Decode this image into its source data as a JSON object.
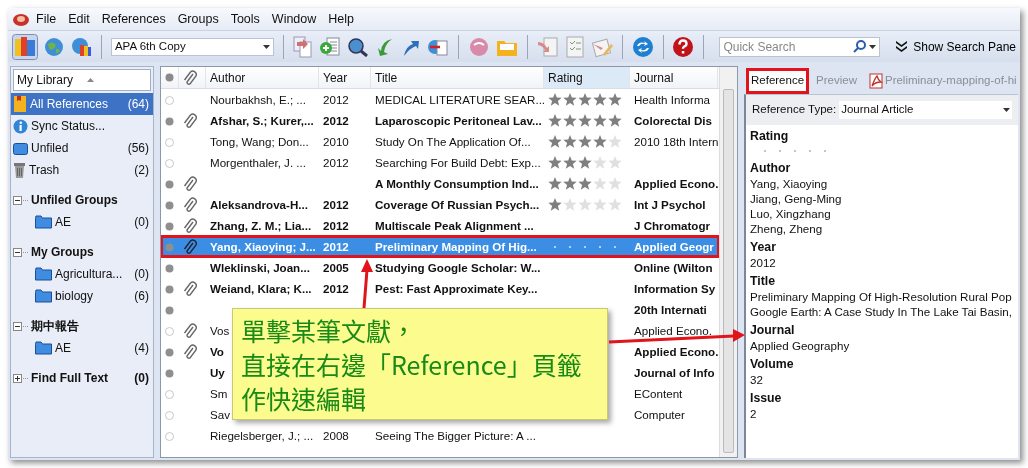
{
  "menu": [
    "File",
    "Edit",
    "References",
    "Groups",
    "Tools",
    "Window",
    "Help"
  ],
  "toolbar": {
    "style": "APA 6th Copy",
    "search_placeholder": "Quick Search",
    "search_panel_button": "Show Search Pane"
  },
  "sidebar": {
    "header": "My Library",
    "items": [
      {
        "label": "All References",
        "count": "(64)",
        "selected": true,
        "kind": "all"
      },
      {
        "label": "Sync Status...",
        "selected": false,
        "kind": "sync"
      },
      {
        "label": "Unfiled",
        "count": "(56)",
        "selected": false,
        "kind": "unfiled"
      },
      {
        "label": "Trash",
        "count": "(2)",
        "selected": false,
        "kind": "trash"
      }
    ],
    "groups": [
      {
        "label": "Unfiled Groups",
        "expanded": true,
        "children": [
          {
            "label": "AE",
            "count": "(0)"
          }
        ]
      },
      {
        "label": "My Groups",
        "expanded": true,
        "children": [
          {
            "label": "Agricultura...",
            "count": "(0)"
          },
          {
            "label": "biology",
            "count": "(6)"
          }
        ]
      },
      {
        "label": "期中報告",
        "expanded": true,
        "children": [
          {
            "label": "AE",
            "count": "(4)"
          }
        ]
      },
      {
        "label": "Find Full Text",
        "count": "(0)",
        "expanded": false
      }
    ]
  },
  "table": {
    "columns": [
      {
        "label": "Author",
        "sorted": false
      },
      {
        "label": "Year",
        "sorted": false
      },
      {
        "label": "Title",
        "sorted": false
      },
      {
        "label": "Rating",
        "sorted": true
      },
      {
        "label": "Journal",
        "sorted": false
      }
    ],
    "rows": [
      {
        "read": true,
        "attachment": false,
        "selected": false,
        "highlighted": false,
        "author": "Nourbakhsh, E.; ...",
        "year": "2012",
        "title": "MEDICAL LITERATURE SEAR...",
        "stars": 5,
        "journal": "Health Informa"
      },
      {
        "read": false,
        "attachment": true,
        "selected": false,
        "highlighted": false,
        "author": "Afshar, S.; Kurer,...",
        "year": "2012",
        "title": "Laparoscopic Peritoneal Lav...",
        "stars": 5,
        "journal": "Colorectal Dis"
      },
      {
        "read": true,
        "attachment": false,
        "selected": false,
        "highlighted": false,
        "author": "Tong, Wang; Don...",
        "year": "2010",
        "title": "Study On The Application Of...",
        "stars": 4,
        "journal": "2010 18th Intern"
      },
      {
        "read": true,
        "attachment": false,
        "selected": false,
        "highlighted": false,
        "author": "Morgenthaler, J. ...",
        "year": "2012",
        "title": "Searching For Build Debt: Exp...",
        "stars": 3
      },
      {
        "read": false,
        "attachment": true,
        "selected": false,
        "highlighted": false,
        "title": "A Monthly Consumption Ind...",
        "stars": 3,
        "journal": "Applied Econo."
      },
      {
        "read": false,
        "attachment": true,
        "selected": false,
        "highlighted": false,
        "author": "Aleksandrova-H...",
        "year": "2012",
        "title": "Coverage Of Russian Psych...",
        "stars": 1,
        "journal": "Int J Psychol"
      },
      {
        "read": false,
        "attachment": true,
        "selected": false,
        "highlighted": false,
        "author": "Zhang, Z. M.; Lia...",
        "year": "2012",
        "title": "Multiscale Peak Alignment ...",
        "journal": "J Chromatogr"
      },
      {
        "read": false,
        "attachment": true,
        "selected": true,
        "highlighted": true,
        "author": "Yang, Xiaoying; J...",
        "year": "2012",
        "title": "Preliminary Mapping Of Hig...",
        "journal": "Applied Geogr"
      },
      {
        "read": false,
        "attachment": false,
        "selected": false,
        "highlighted": false,
        "author": "Wleklinski, Joan...",
        "year": "2005",
        "title": "Studying Google Scholar: W...",
        "journal": "Online (Wilton"
      },
      {
        "read": false,
        "attachment": true,
        "selected": false,
        "highlighted": false,
        "author": "Weiand, Klara; K...",
        "year": "2012",
        "title": "Pest: Fast Approximate Key...",
        "journal": "Information Sy"
      },
      {
        "read": false,
        "attachment": false,
        "selected": false,
        "highlighted": false,
        "journal": "20th Internati"
      },
      {
        "read": true,
        "attachment": true,
        "selected": false,
        "highlighted": false,
        "author": "Vos",
        "journal": "Applied Econo."
      },
      {
        "read": false,
        "attachment": true,
        "selected": false,
        "highlighted": false,
        "author": "Vo",
        "journal": "Applied Econo."
      },
      {
        "read": false,
        "attachment": false,
        "selected": false,
        "highlighted": false,
        "author": "Uy",
        "journal": "Journal of Info"
      },
      {
        "read": true,
        "attachment": false,
        "selected": false,
        "highlighted": false,
        "author": "Sm",
        "journal": "EContent"
      },
      {
        "read": true,
        "attachment": false,
        "selected": false,
        "highlighted": false,
        "author": "Sav",
        "journal": "Computer"
      },
      {
        "read": true,
        "attachment": false,
        "selected": false,
        "highlighted": false,
        "author": "Riegelsberger, J.; ...",
        "year": "2008",
        "title": "Seeing The Bigger Picture: A ..."
      }
    ]
  },
  "reference_panel": {
    "tabs": [
      {
        "label": "Reference",
        "kind": "tab",
        "selected": true,
        "highlighted": true
      },
      {
        "label": "Preview",
        "kind": "tab",
        "selected": false,
        "highlighted": false
      },
      {
        "label": "Preliminary-mapping-of-hi",
        "kind": "pdf",
        "selected": false,
        "highlighted": false
      }
    ],
    "reference_type_label": "Reference Type:",
    "reference_type": "Journal Article",
    "fields": [
      {
        "label": "Rating",
        "kind": "rating",
        "stars": 0
      },
      {
        "label": "Author",
        "kind": "text",
        "values": [
          "Yang, Xiaoying",
          "Jiang, Geng-Ming",
          "Luo, Xingzhang",
          "Zheng, Zheng"
        ]
      },
      {
        "label": "Year",
        "kind": "text",
        "values": [
          "2012"
        ]
      },
      {
        "label": "Title",
        "kind": "text",
        "values": [
          "Preliminary Mapping Of High-Resolution Rural Pop",
          "Google Earth: A Case Study In The Lake Tai Basin,"
        ]
      },
      {
        "label": "Journal",
        "kind": "text",
        "values": [
          "Applied Geography"
        ]
      },
      {
        "label": "Volume",
        "kind": "text",
        "values": [
          "32"
        ]
      },
      {
        "label": "Issue",
        "kind": "text",
        "values": [
          "2"
        ]
      }
    ]
  },
  "callout": {
    "lines": [
      "單擊某筆文獻，",
      "直接在右邊「Reference」頁籤",
      "作快速編輯"
    ]
  }
}
